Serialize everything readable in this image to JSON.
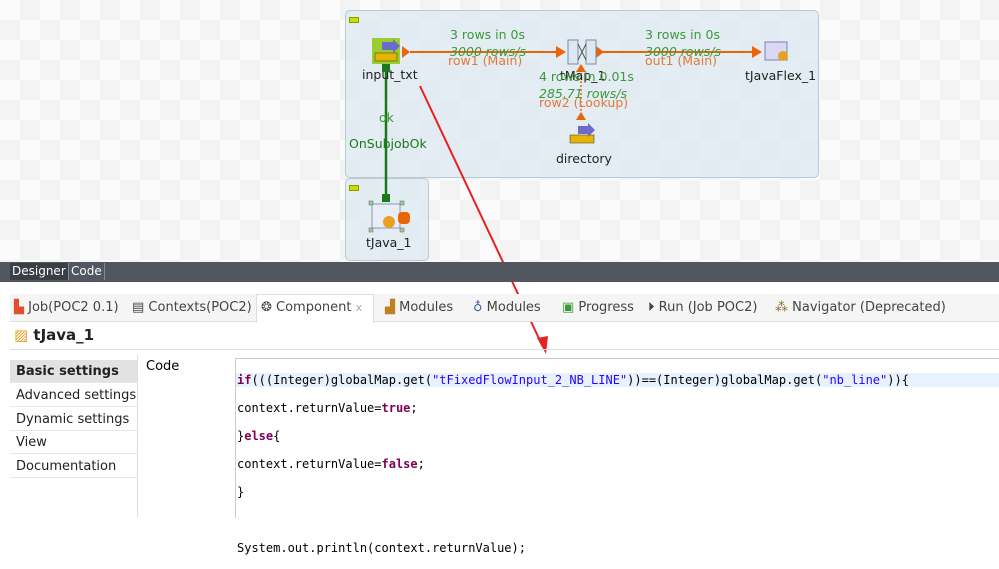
{
  "designer": {
    "components": {
      "input": "input_txt",
      "tmap": "tMap_1",
      "flex": "tJavaFlex_1",
      "directory": "directory",
      "tjava": "tJava_1"
    },
    "links": {
      "row1_stats": "3 rows in 0s",
      "row1_rate": "3000 rows/s",
      "row1_name": "row1 (Main)",
      "out1_stats": "3 rows in 0s",
      "out1_rate": "3000 rows/s",
      "out1_name": "out1 (Main)",
      "row2_stats": "4 rows in 0.01s",
      "row2_rate": "285.71 rows/s",
      "row2_name": "row2 (Lookup)",
      "ok": "ok",
      "onsubjob": "OnSubjobOk"
    }
  },
  "editor_tabs": [
    "Designer",
    "Code"
  ],
  "view_tabs": [
    "Job(POC2 0.1)",
    "Contexts(POC2)",
    "Component",
    "Modules",
    "Modules",
    "Progress",
    "Run (Job POC2)",
    "Navigator (Deprecated)"
  ],
  "component_title": "tJava_1",
  "settings_menu": [
    "Basic settings",
    "Advanced settings",
    "Dynamic settings",
    "View",
    "Documentation"
  ],
  "code_label": "Code",
  "code": {
    "l1a": "if",
    "l1b": "(((Integer)globalMap.get(",
    "l1c": "\"tFixedFlowInput_2_NB_LINE\"",
    "l1d": "))==(Integer)globalMap.get(",
    "l1e": "\"nb_line\"",
    "l1f": ")){",
    "l2a": "context.returnValue=",
    "l2b": "true",
    "l2c": ";",
    "l3a": "}",
    "l3b": "else",
    "l3c": "{",
    "l4a": "context.returnValue=",
    "l4b": "false",
    "l4c": ";",
    "l5": "}",
    "l7": "System.out.println(context.returnValue);"
  },
  "colors": {
    "main_link": "#e8650a",
    "trigger_link": "#1a7a1a",
    "annotation_arrow": "#e82020"
  }
}
